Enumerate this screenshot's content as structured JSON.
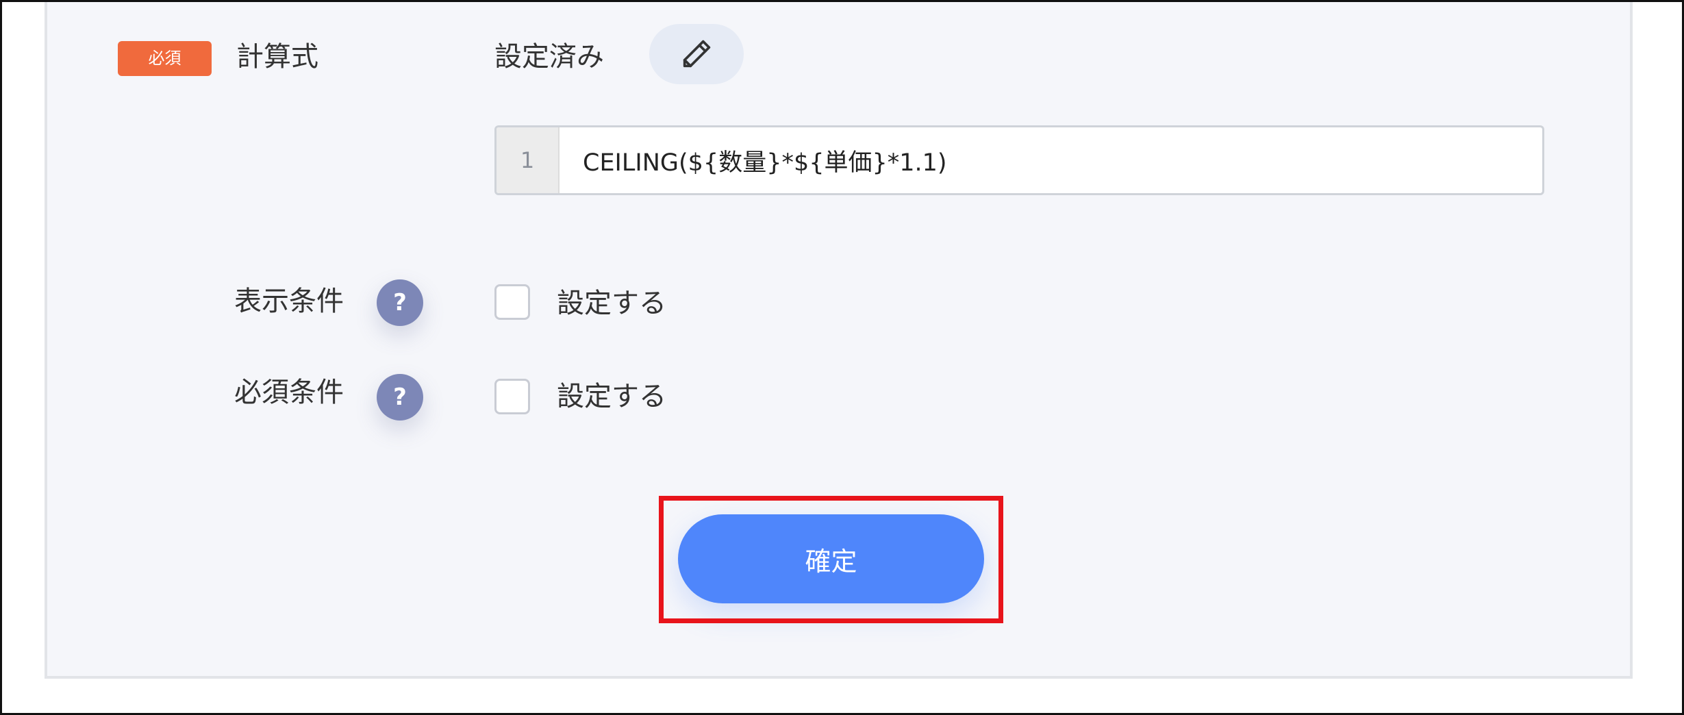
{
  "formula_field": {
    "required_badge": "必須",
    "label": "計算式",
    "status": "設定済み",
    "edit_icon": "pencil-icon",
    "editor": {
      "line_number": "1",
      "code": "CEILING(${数量}*${単価}*1.1)"
    }
  },
  "display_condition": {
    "label": "表示条件",
    "help_icon": "?",
    "checkbox_label": "設定する",
    "checked": false
  },
  "required_condition": {
    "label": "必須条件",
    "help_icon": "?",
    "checkbox_label": "設定する",
    "checked": false
  },
  "confirm_button": {
    "label": "確定"
  },
  "colors": {
    "badge": "#f06a3d",
    "primary": "#4f86fb",
    "help_icon": "#7d87b7",
    "highlight": "#e8141b",
    "panel_background": "#f5f6fa"
  }
}
